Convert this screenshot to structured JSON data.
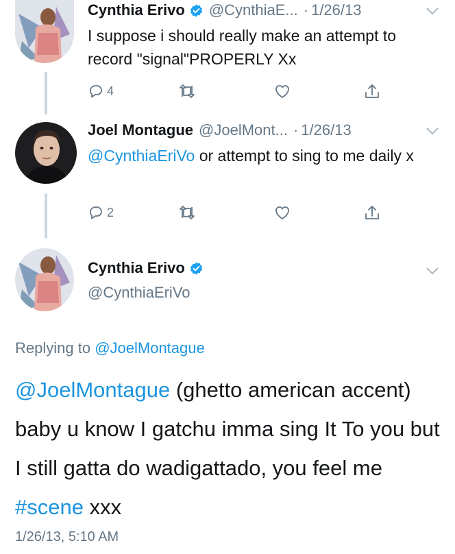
{
  "tweets": [
    {
      "name": "Cynthia Erivo",
      "handle": "@CynthiaE...",
      "separator": "·",
      "date": "1/26/13",
      "text": "I suppose i should really make an attempt to record \"signal\"PROPERLY Xx",
      "reply_count": "4",
      "verified": true
    },
    {
      "name": "Joel Montague",
      "handle": "@JoelMont...",
      "separator": "·",
      "date": "1/26/13",
      "mention": "@CynthiaEriVo",
      "text": " or attempt to sing to me daily x",
      "reply_count": "2",
      "verified": false
    }
  ],
  "main_tweet": {
    "name": "Cynthia Erivo",
    "handle": "@CynthiaEriVo",
    "replying_to_prefix": "Replying to ",
    "replying_to_handle": "@JoelMontague",
    "mention": "@JoelMontague",
    "text_part1": " (ghetto american accent) baby u know I gatchu imma sing It To you but I still gatta do wadigattado, you feel me ",
    "hashtag": "#scene",
    "text_part2": " xxx",
    "timestamp": "1/26/13, 5:10 AM"
  },
  "icons": [
    "reply-icon",
    "retweet-icon",
    "like-icon",
    "share-icon",
    "verified-badge-icon",
    "chevron-down-icon"
  ],
  "colors": {
    "link": "#1b95e0",
    "secondary": "#657786",
    "verified": "#1da1f2",
    "thread_line": "#ccd6dd"
  }
}
